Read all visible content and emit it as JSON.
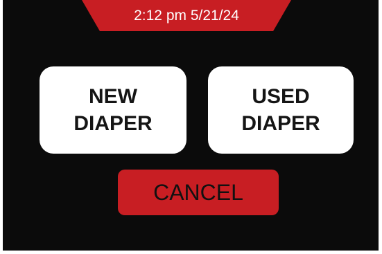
{
  "header": {
    "time": "2:12 pm 5/21/24"
  },
  "buttons": {
    "new_diaper": {
      "line1": "NEW",
      "line2": "DIAPER"
    },
    "used_diaper": {
      "line1": "USED",
      "line2": "DIAPER"
    },
    "cancel": "CANCEL"
  },
  "colors": {
    "background": "#0b0b0b",
    "banner": "#c81e23",
    "cancel_button": "#c81e23",
    "choice_button": "#ffffff"
  }
}
